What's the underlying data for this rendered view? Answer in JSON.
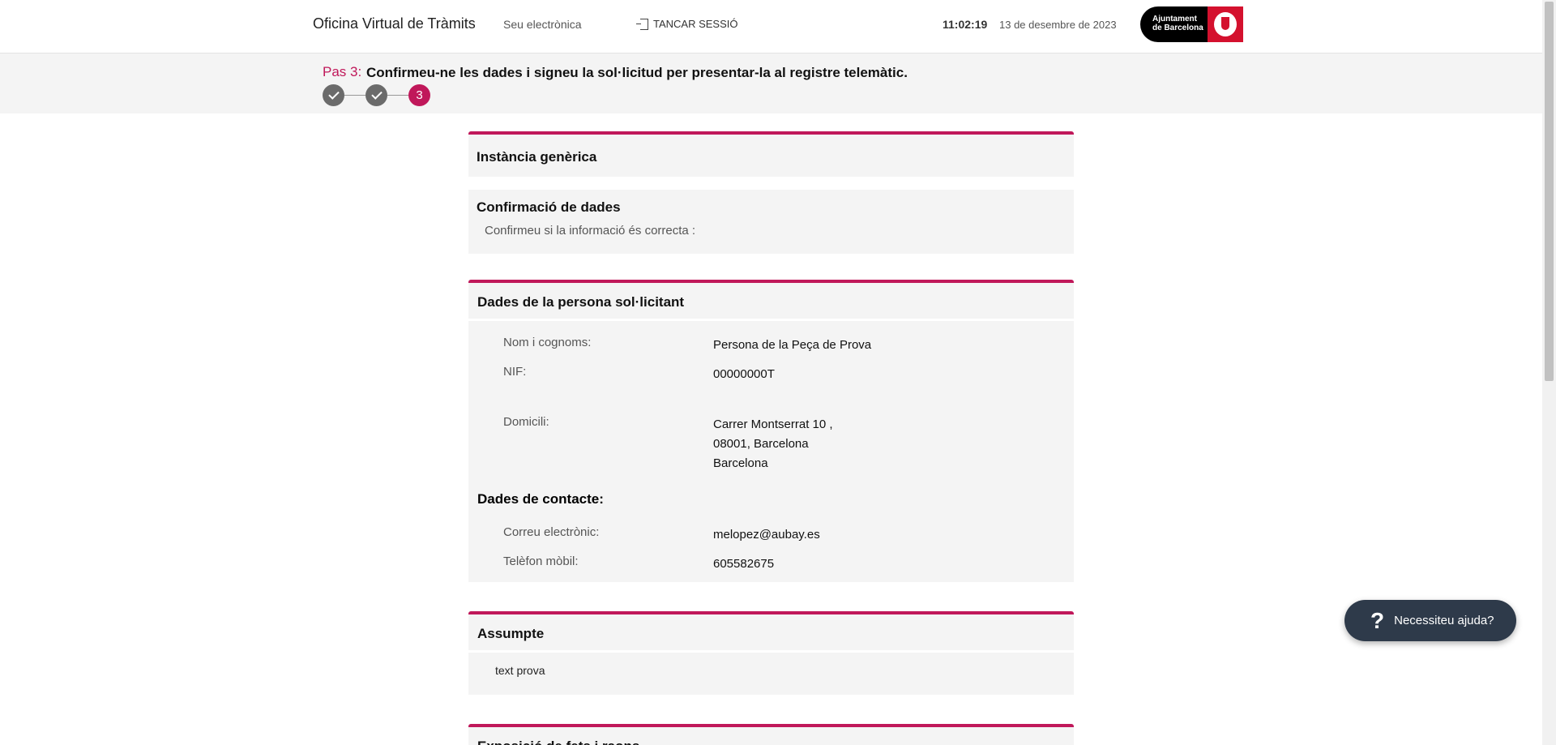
{
  "header": {
    "app_title": "Oficina Virtual de Tràmits",
    "seu": "Seu electrònica",
    "logout": "TANCAR SESSIÓ",
    "clock": "11:02:19",
    "date": "13 de desembre de 2023",
    "brand_line1": "Ajuntament",
    "brand_line2": "de Barcelona"
  },
  "stepbar": {
    "prefix": "Pas 3:",
    "text": "Confirmeu-ne les dades i signeu la sol·licitud per presentar-la al registre telemàtic.",
    "current_step": "3"
  },
  "cards": {
    "instancia": "Instància genèrica",
    "confirmacio_title": "Confirmació de dades",
    "confirmacio_sub": "Confirmeu si la informació és correcta :",
    "persona_title": "Dades de la persona sol·licitant",
    "nom_label": "Nom i cognoms:",
    "nom_value": "Persona de la Peça de Prova",
    "nif_label": "NIF:",
    "nif_value": "00000000T",
    "domicili_label": "Domicili:",
    "domicili_line1": "Carrer Montserrat 10 ,",
    "domicili_line2": "08001, Barcelona",
    "domicili_line3": "Barcelona",
    "contacte_title": "Dades de contacte:",
    "correu_label": "Correu electrònic:",
    "correu_value": "melopez@aubay.es",
    "telefon_label": "Telèfon mòbil:",
    "telefon_value": "605582675",
    "assumpte_title": "Assumpte",
    "assumpte_value": "text prova",
    "exposicio_title": "Exposició de fets i raons"
  },
  "help": {
    "label": "Necessiteu ajuda?",
    "icon": "?"
  },
  "colors": {
    "accent": "#c0185a",
    "brand_red": "#d4112e",
    "help_bg": "#2e3a4a"
  }
}
